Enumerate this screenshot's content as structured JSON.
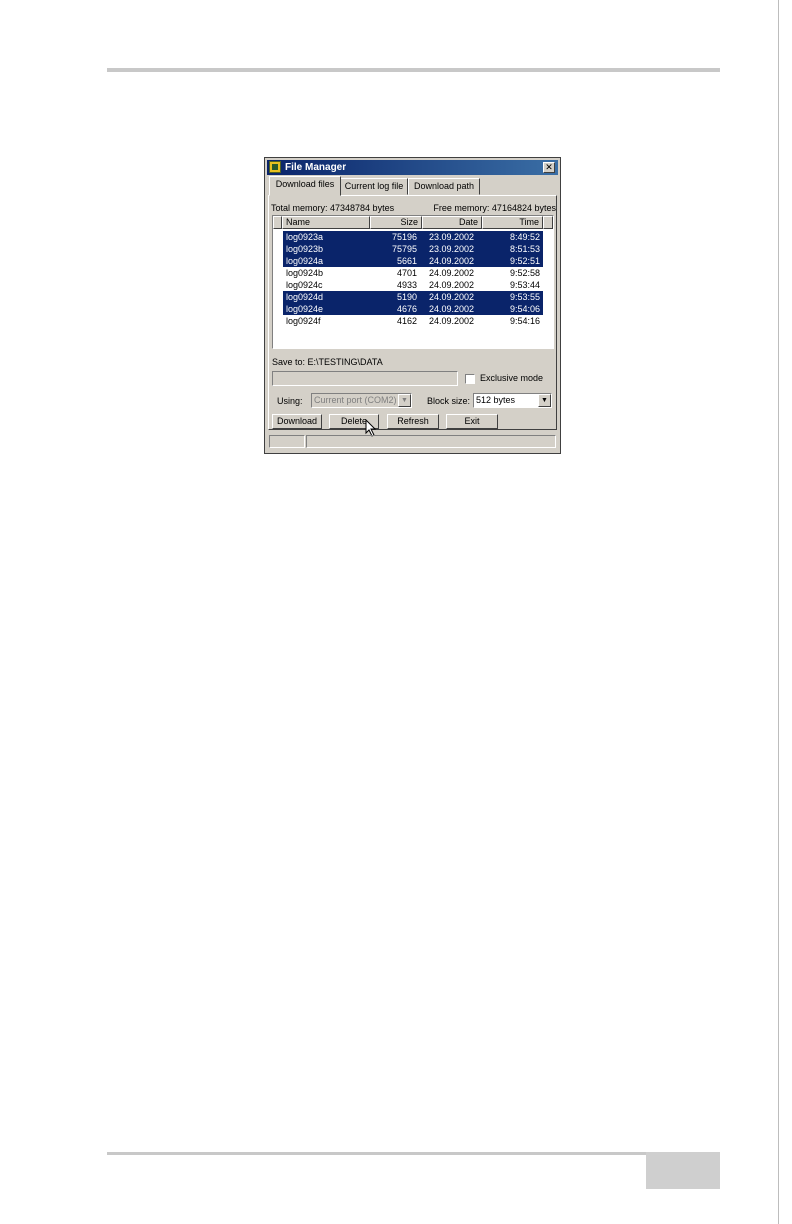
{
  "window": {
    "title": "File Manager",
    "close_symbol": "✕"
  },
  "tabs": [
    "Download files",
    "Current log file",
    "Download path"
  ],
  "memory": {
    "total": "Total memory: 47348784 bytes",
    "free": "Free memory: 47164824 bytes"
  },
  "list": {
    "columns": [
      "Name",
      "Size",
      "Date",
      "Time"
    ],
    "rows": [
      {
        "name": "log0923a",
        "size": "75196",
        "date": "23.09.2002",
        "time": "8:49:52",
        "selected": true
      },
      {
        "name": "log0923b",
        "size": "75795",
        "date": "23.09.2002",
        "time": "8:51:53",
        "selected": true
      },
      {
        "name": "log0924a",
        "size": "5661",
        "date": "24.09.2002",
        "time": "9:52:51",
        "selected": true
      },
      {
        "name": "log0924b",
        "size": "4701",
        "date": "24.09.2002",
        "time": "9:52:58",
        "selected": false
      },
      {
        "name": "log0924c",
        "size": "4933",
        "date": "24.09.2002",
        "time": "9:53:44",
        "selected": false
      },
      {
        "name": "log0924d",
        "size": "5190",
        "date": "24.09.2002",
        "time": "9:53:55",
        "selected": true
      },
      {
        "name": "log0924e",
        "size": "4676",
        "date": "24.09.2002",
        "time": "9:54:06",
        "selected": true
      },
      {
        "name": "log0924f",
        "size": "4162",
        "date": "24.09.2002",
        "time": "9:54:16",
        "selected": false
      }
    ]
  },
  "save_to": "Save to: E:\\TESTING\\DATA",
  "exclusive_mode": {
    "label": "Exclusive mode",
    "checked": false
  },
  "using": {
    "label": "Using:",
    "value": "Current port (COM2)"
  },
  "block_size": {
    "label": "Block size:",
    "value": "512 bytes"
  },
  "buttons": {
    "download": "Download",
    "delete": "Delete",
    "refresh": "Refresh",
    "exit": "Exit"
  },
  "icons": {
    "app": "app-icon",
    "close": "close-icon",
    "dropdown": "chevron-down-icon",
    "cursor": "mouse-pointer-icon"
  },
  "colors": {
    "title_bar": "#0a246a",
    "selection": "#0a246a",
    "face": "#d4d0c8"
  }
}
